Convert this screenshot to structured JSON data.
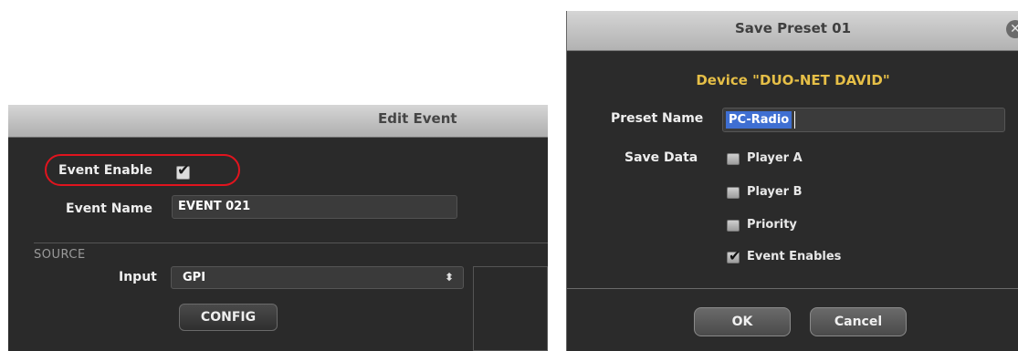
{
  "edit_event": {
    "title": "Edit Event",
    "event_enable_label": "Event Enable",
    "event_enable_checked": true,
    "event_name_label": "Event Name",
    "event_name_value": "EVENT 021",
    "source_section": "SOURCE",
    "input_label": "Input",
    "input_value": "GPI",
    "config_button": "CONFIG",
    "highlight_color": "#e1141e"
  },
  "save_preset": {
    "title": "Save Preset 01",
    "device_line": "Device \"DUO-NET DAVID\"",
    "device_color": "#e6bf47",
    "preset_name_label": "Preset Name",
    "preset_name_value": "PC-Radio",
    "save_data_label": "Save Data",
    "save_data_items": [
      {
        "label": "Player A",
        "checked": false
      },
      {
        "label": "Player B",
        "checked": false
      },
      {
        "label": "Priority",
        "checked": false
      },
      {
        "label": "Event Enables",
        "checked": true
      }
    ],
    "ok_button": "OK",
    "cancel_button": "Cancel",
    "close_icon": "close-icon"
  }
}
